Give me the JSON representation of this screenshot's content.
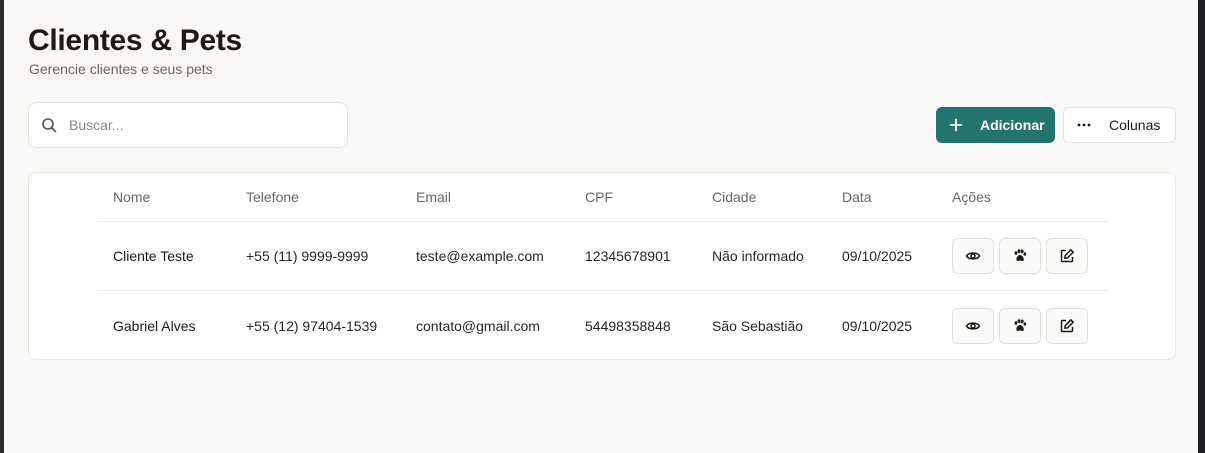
{
  "header": {
    "title": "Clientes & Pets",
    "subtitle": "Gerencie clientes e seus pets"
  },
  "toolbar": {
    "search_placeholder": "Buscar...",
    "add_label": "Adicionar",
    "columns_label": "Colunas"
  },
  "table": {
    "headers": [
      "Nome",
      "Telefone",
      "Email",
      "CPF",
      "Cidade",
      "Data",
      "Ações"
    ],
    "rows": [
      {
        "nome": "Cliente Teste",
        "telefone": "+55 (11) 9999-9999",
        "email": "teste@example.com",
        "cpf": "12345678901",
        "cidade": "Não informado",
        "data": "09/10/2025"
      },
      {
        "nome": "Gabriel Alves",
        "telefone": "+55 (12) 97404-1539",
        "email": "contato@gmail.com",
        "cpf": "54498358848",
        "cidade": "São Sebastião",
        "data": "09/10/2025"
      }
    ],
    "row_actions": [
      "eye-icon",
      "paw-icon",
      "edit-icon"
    ]
  },
  "colors": {
    "accent": "#23736f",
    "background": "#f9f8f6"
  }
}
